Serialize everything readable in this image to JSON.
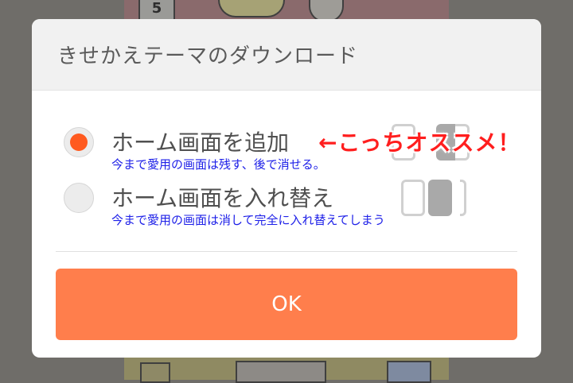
{
  "background": {
    "calendar_day": "5"
  },
  "dialog": {
    "title": "きせかえテーマのダウンロード",
    "options": [
      {
        "label": "ホーム画面を追加",
        "selected": true,
        "annotation": "今まで愛用の画面は残す、後で消せる。"
      },
      {
        "label": "ホーム画面を入れ替え",
        "selected": false,
        "annotation": "今まで愛用の画面は消して完全に入れ替えてしまう"
      }
    ],
    "recommendation": "←こっちオススメ！",
    "ok_label": "OK"
  },
  "colors": {
    "accent": "#ff7e4c",
    "radio_selected": "#ff5a1f",
    "annotation_blue": "#1e20e8",
    "recommendation_red": "#ff1e1e",
    "scrim": "#6f6d69"
  }
}
